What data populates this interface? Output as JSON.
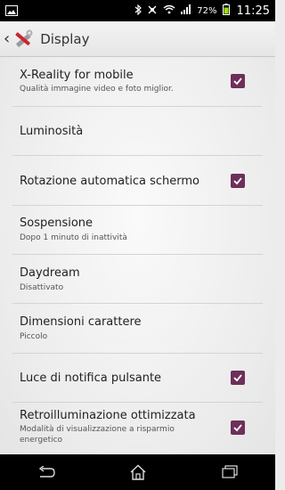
{
  "status_bar": {
    "battery_percent": "72%",
    "time": "11:25"
  },
  "action_bar": {
    "title": "Display"
  },
  "settings": [
    {
      "title": "X-Reality for mobile",
      "subtitle": "Qualità immagine video e foto miglior.",
      "checked": true
    },
    {
      "title": "Luminosità",
      "subtitle": "",
      "checked": null
    },
    {
      "title": "Rotazione automatica schermo",
      "subtitle": "",
      "checked": true
    },
    {
      "title": "Sospensione",
      "subtitle": "Dopo 1 minuto di inattività",
      "checked": null
    },
    {
      "title": "Daydream",
      "subtitle": "Disattivato",
      "checked": null
    },
    {
      "title": "Dimensioni carattere",
      "subtitle": "Piccolo",
      "checked": null
    },
    {
      "title": "Luce di notifica pulsante",
      "subtitle": "",
      "checked": true
    },
    {
      "title": "Retroilluminazione ottimizzata",
      "subtitle": "Modalità di visualizzazione a risparmio energetico",
      "checked": true
    }
  ],
  "colors": {
    "checkbox": "#6e2f5a",
    "status_bar": "#000000"
  }
}
